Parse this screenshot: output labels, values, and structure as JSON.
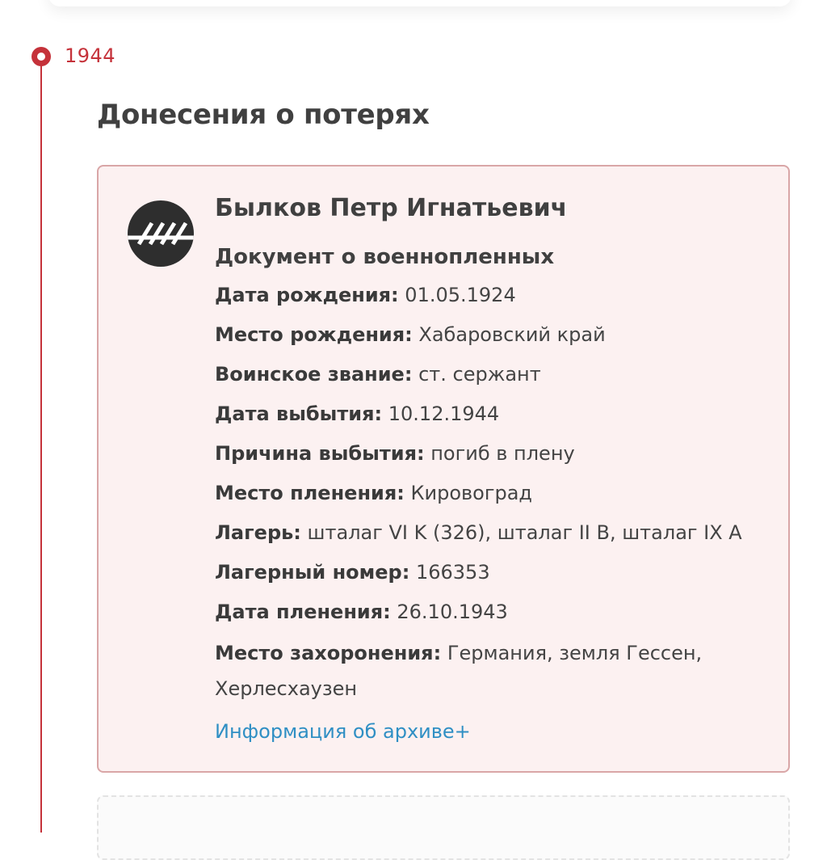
{
  "timeline": {
    "year": "1944"
  },
  "section": {
    "title": "Донесения о потерях"
  },
  "record": {
    "name": "Былков Петр Игнатьевич",
    "document_type": "Документ о военнопленных",
    "fields": [
      {
        "label": "Дата рождения:",
        "value": "01.05.1924"
      },
      {
        "label": "Место рождения:",
        "value": "Хабаровский край"
      },
      {
        "label": "Воинское звание:",
        "value": "ст. сержант"
      },
      {
        "label": "Дата выбытия:",
        "value": "10.12.1944"
      },
      {
        "label": "Причина выбытия:",
        "value": "погиб в плену"
      },
      {
        "label": "Место пленения:",
        "value": "Кировоград"
      },
      {
        "label": "Лагерь:",
        "value": "шталаг VI K (326), шталаг II B, шталаг IX A"
      },
      {
        "label": "Лагерный номер:",
        "value": "166353"
      },
      {
        "label": "Дата пленения:",
        "value": "26.10.1943"
      },
      {
        "label": "Место захоронения:",
        "value": "Германия, земля Гессен, Херлесхаузен"
      }
    ],
    "archive_link": "Информация об архиве+"
  },
  "colors": {
    "accent": "#c5323a",
    "card_bg": "#fcf1f1",
    "card_border": "#d9a6a7",
    "link": "#2f8fc4"
  }
}
